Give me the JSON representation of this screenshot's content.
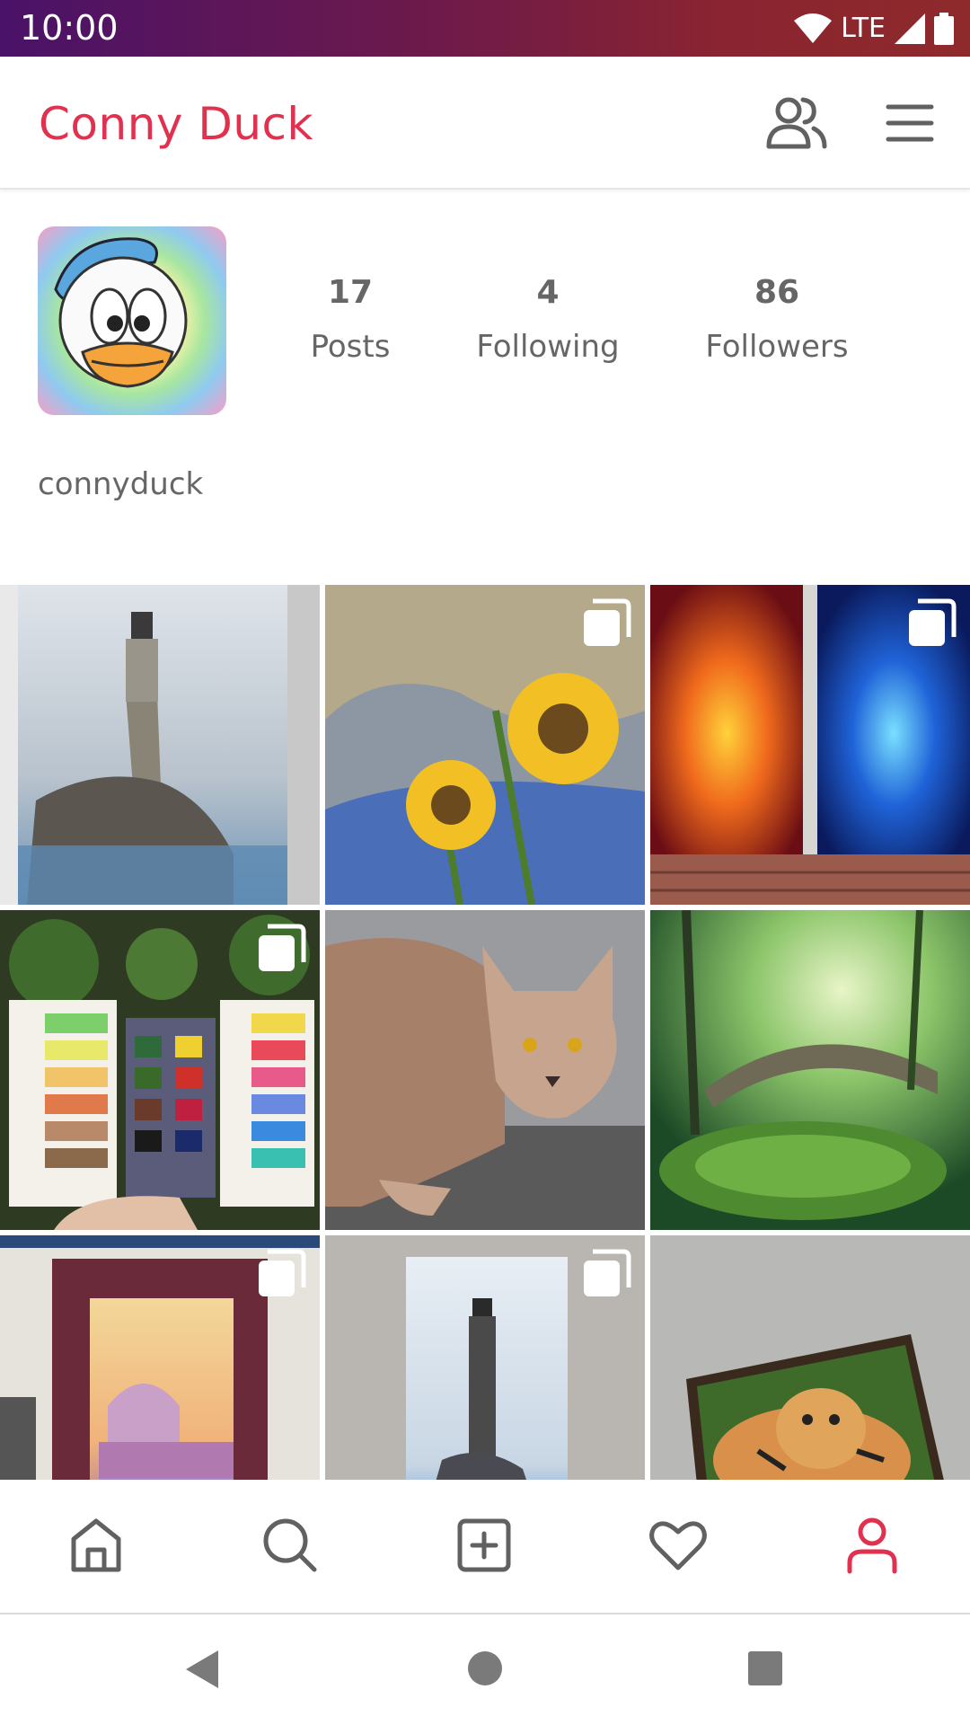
{
  "status_bar": {
    "time": "10:00",
    "network": "LTE",
    "icons": [
      "wifi-icon",
      "signal-icon",
      "battery-icon"
    ]
  },
  "app_bar": {
    "title": "Conny Duck",
    "icons": [
      "friends-icon",
      "menu-icon"
    ],
    "title_color": "#e0314f"
  },
  "profile": {
    "posts": {
      "count": "17",
      "label": "Posts"
    },
    "following": {
      "count": "4",
      "label": "Following"
    },
    "followers": {
      "count": "86",
      "label": "Followers"
    },
    "username": "connyduck"
  },
  "grid": {
    "tiles": [
      {
        "subject": "watercolor lighthouse on rock",
        "multiple": false
      },
      {
        "subject": "sunflowers painting",
        "multiple": true
      },
      {
        "subject": "two pixel mosaic canvases red and blue",
        "multiple": true
      },
      {
        "subject": "watercolor paint palette with swatches",
        "multiple": true
      },
      {
        "subject": "lynx painting",
        "multiple": false
      },
      {
        "subject": "forest stone bridge painting",
        "multiple": false
      },
      {
        "subject": "framed Venice watercolor",
        "multiple": true
      },
      {
        "subject": "lighthouse canvas painting",
        "multiple": true
      },
      {
        "subject": "tiger painting canvas",
        "multiple": false
      }
    ]
  },
  "bottom_nav": {
    "items": [
      "home-icon",
      "search-icon",
      "add-post-icon",
      "favourites-icon",
      "profile-icon"
    ],
    "active": "profile-icon",
    "active_color": "#e0314f",
    "inactive_color": "#616161"
  },
  "system_nav": {
    "items": [
      "back-icon",
      "home-circle-icon",
      "recents-icon"
    ]
  }
}
